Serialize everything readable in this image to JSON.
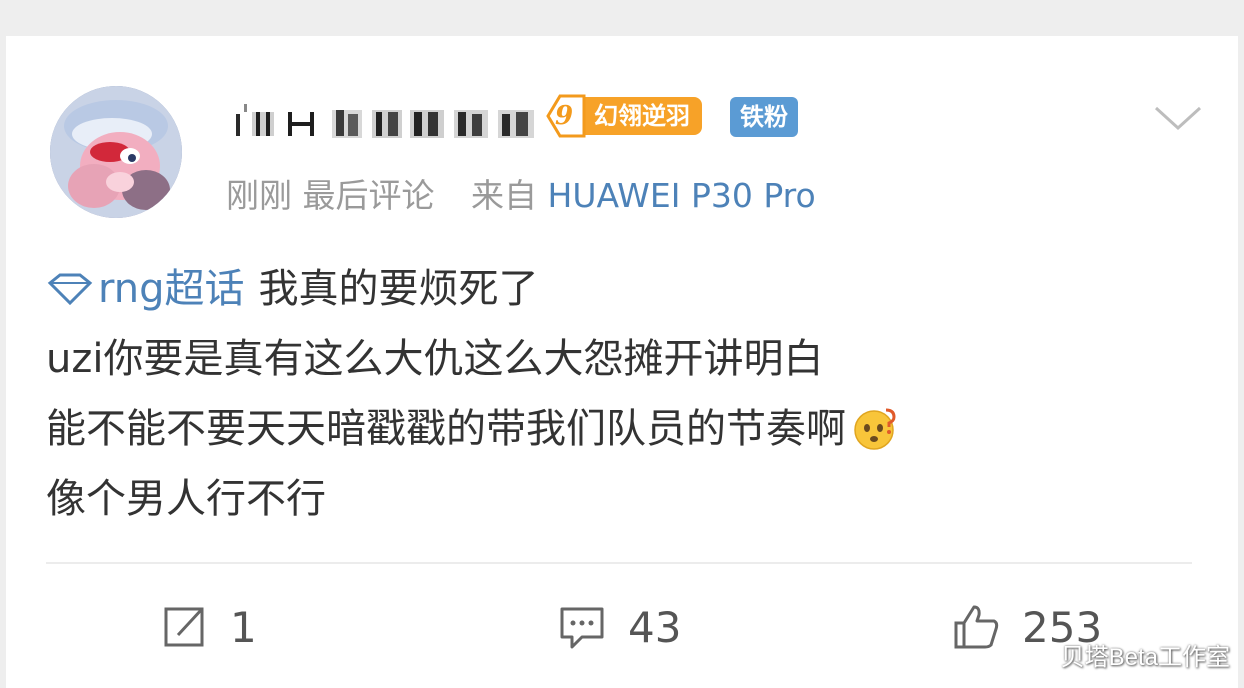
{
  "post": {
    "username": "",
    "level_badge": {
      "level": "9",
      "name": "幻翎逆羽",
      "color": "#f7a228"
    },
    "fan_badge": {
      "label": "铁粉",
      "color": "#5b9bd4"
    },
    "meta": {
      "time": "刚刚",
      "activity": "最后评论",
      "source_prefix": "来自",
      "device": "HUAWEI P30 Pro"
    },
    "topic": "rng超话",
    "content_lines": [
      "我真的要烦死了",
      "uzi你要是真有这么大仇这么大怨摊开讲明白",
      "能不能不要天天暗戳戳的带我们队员的节奏啊",
      "像个男人行不行"
    ],
    "emoji": "thinking-face-emoji"
  },
  "actions": {
    "repost_count": "1",
    "comment_count": "43",
    "like_count": "253"
  },
  "watermark": "贝塔Beta工作室",
  "colors": {
    "link": "#4d82b8",
    "text": "#333333",
    "meta": "#9a9a9a"
  }
}
